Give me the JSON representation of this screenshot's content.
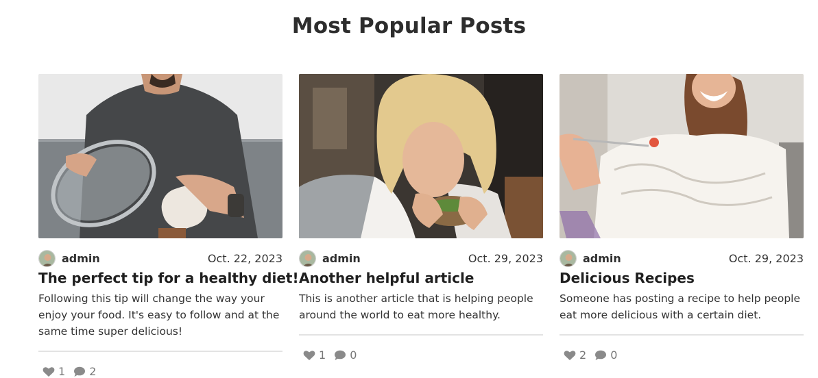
{
  "section_title": "Most Popular Posts",
  "icons": {
    "like": "heart-icon",
    "comment": "speech-bubble-icon"
  },
  "colors": {
    "icon": "#8a8a8a",
    "divider": "#e3e3e3"
  },
  "posts": [
    {
      "author": "admin",
      "date": "Oct. 22, 2023",
      "title": "The perfect tip for a healthy diet!",
      "excerpt": "Following this tip will change the way your enjoy your food. It's easy to follow and at the same time super delicious!",
      "likes": "1",
      "comments": "2"
    },
    {
      "author": "admin",
      "date": "Oct. 29, 2023",
      "title": "Another helpful article",
      "excerpt": "This is another article that is helping people around the world to eat more healthy.",
      "likes": "1",
      "comments": "0"
    },
    {
      "author": "admin",
      "date": "Oct. 29, 2023",
      "title": "Delicious Recipes",
      "excerpt": "Someone has posting a recipe to help people eat more delicious with a certain diet.",
      "likes": "2",
      "comments": "0"
    }
  ]
}
